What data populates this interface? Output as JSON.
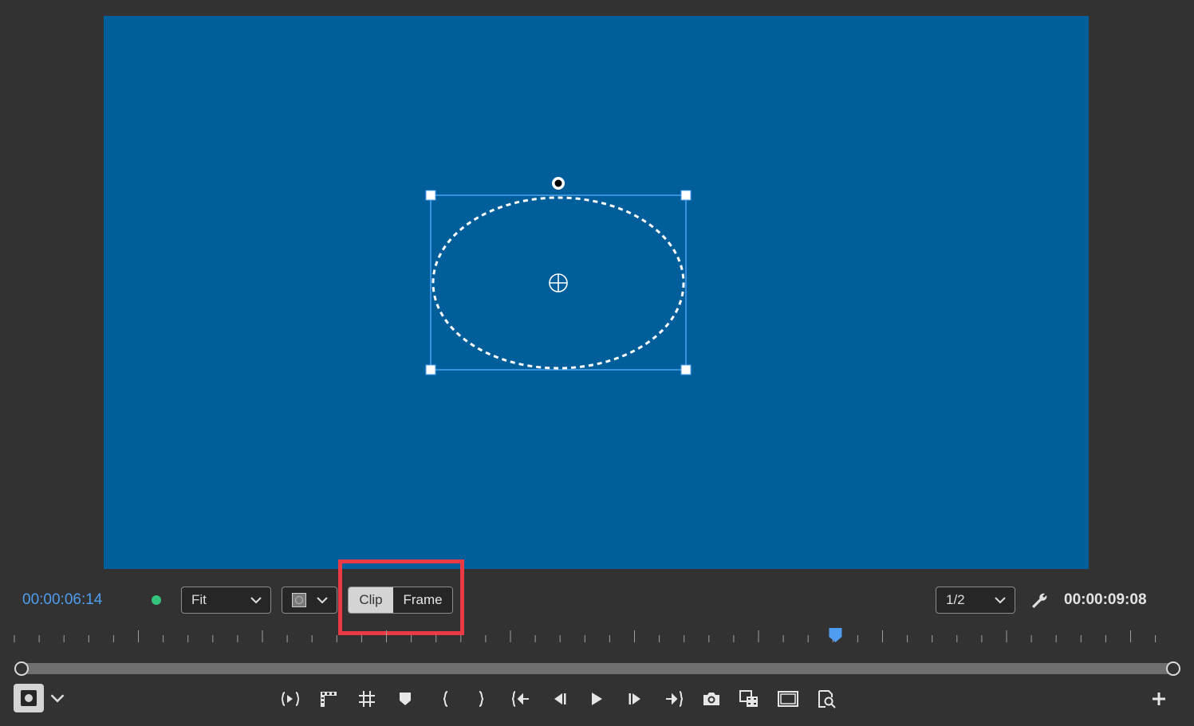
{
  "viewer": {
    "background_color": "#005e9b",
    "mask_shape": "ellipse",
    "selection_color": "#4ea3f5"
  },
  "controls": {
    "current_timecode": "00:00:06:14",
    "current_timecode_color": "#4f9df0",
    "status_dot_color": "#34c37a",
    "zoom_label": "Fit",
    "overlay_icon": "overlay-square-icon",
    "mode_toggle": {
      "clip_label": "Clip",
      "frame_label": "Frame",
      "selected": "Clip"
    },
    "highlight_color": "#ea3a45",
    "resolution_label": "1/2",
    "duration_timecode": "00:00:09:08"
  },
  "timeline": {
    "playhead_fraction": 0.708,
    "playhead_color": "#4f9df0"
  },
  "transport": {
    "safe_margin_icon": "safe-margins-icon",
    "tools": [
      "insert-edit-icon",
      "clapperboard-icon",
      "grid-icon",
      "marker-icon",
      "mark-in-icon",
      "mark-out-icon",
      "go-to-in-icon",
      "step-back-icon",
      "play-icon",
      "step-forward-icon",
      "go-to-out-icon",
      "camera-icon",
      "compare-icon",
      "monitor-icon",
      "proxy-search-icon"
    ],
    "add_icon": "plus-icon"
  }
}
